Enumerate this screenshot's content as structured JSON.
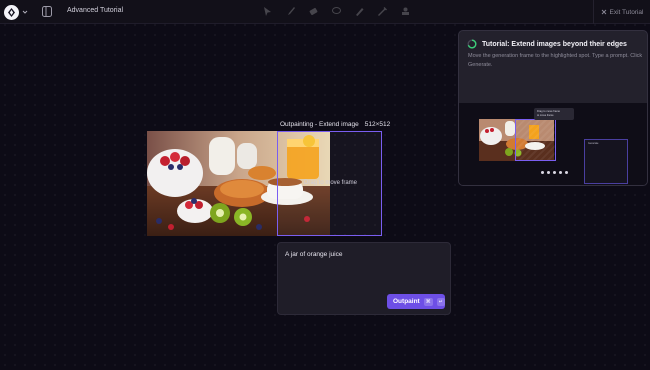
{
  "topbar": {
    "title": "Advanced Tutorial",
    "exit_label": "Exit Tutorial",
    "tools": [
      "pointer-icon",
      "brush-icon",
      "eraser-icon",
      "lasso-icon",
      "pen-icon",
      "pencil-icon",
      "stamp-icon"
    ]
  },
  "canvas": {
    "frame_label": "Outpainting - Extend image",
    "frame_size": "512×512",
    "drag_hint": "Drag to move frame"
  },
  "prompt": {
    "text": "A jar of orange juice",
    "button_label": "Outpaint",
    "shortcut_cmd": "⌘",
    "shortcut_enter": "↵"
  },
  "tutorial_card": {
    "title": "Tutorial: Extend images beyond their edges",
    "description": "Move the generation frame to the highlighted spot. Type a prompt. Click Generate.",
    "preview_tip_title": "Drag to move frame",
    "preview_tip_body": "to move frame",
    "preview_panel_label": "Generate",
    "dot_count": 5
  },
  "colors": {
    "accent": "#6d4fe6",
    "frame_border": "#7a5ef0",
    "background": "#0d0b16"
  }
}
